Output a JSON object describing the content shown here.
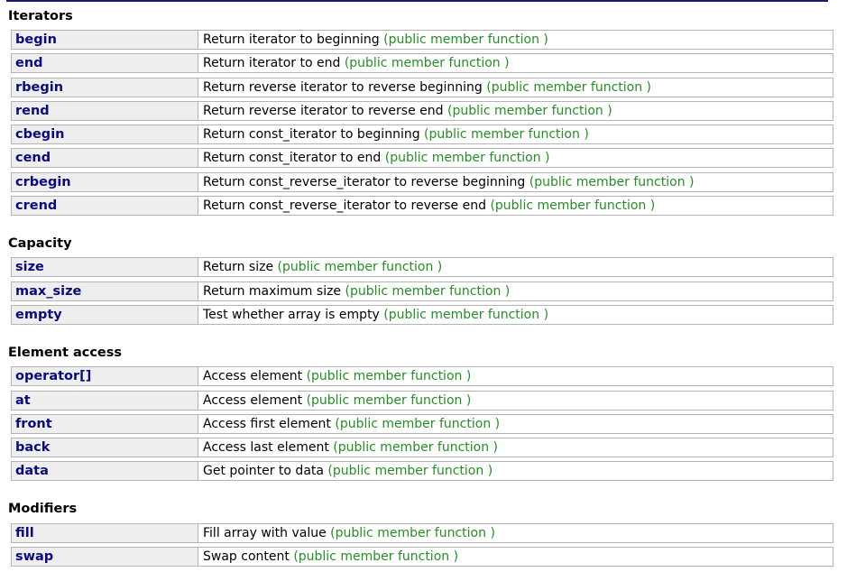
{
  "colors": {
    "name_text": "#0b0b7a",
    "kind_text": "#2a8a2a",
    "name_cell_bg": "#eeeeee",
    "border": "#b4b4b4",
    "top_rule": "#1a1a6e"
  },
  "sections": [
    {
      "title": "Iterators",
      "rows": [
        {
          "name": "begin",
          "desc": "Return iterator to beginning",
          "kind": "(public member function )"
        },
        {
          "name": "end",
          "desc": "Return iterator to end",
          "kind": "(public member function )"
        },
        {
          "name": "rbegin",
          "desc": "Return reverse iterator to reverse beginning",
          "kind": "(public member function )"
        },
        {
          "name": "rend",
          "desc": "Return reverse iterator to reverse end",
          "kind": "(public member function )"
        },
        {
          "name": "cbegin",
          "desc": "Return const_iterator to beginning",
          "kind": "(public member function )"
        },
        {
          "name": "cend",
          "desc": "Return const_iterator to end",
          "kind": "(public member function )"
        },
        {
          "name": "crbegin",
          "desc": "Return const_reverse_iterator to reverse beginning",
          "kind": "(public member function )"
        },
        {
          "name": "crend",
          "desc": "Return const_reverse_iterator to reverse end",
          "kind": "(public member function )"
        }
      ]
    },
    {
      "title": "Capacity",
      "rows": [
        {
          "name": "size",
          "desc": "Return size",
          "kind": "(public member function )"
        },
        {
          "name": "max_size",
          "desc": "Return maximum size",
          "kind": "(public member function )"
        },
        {
          "name": "empty",
          "desc": "Test whether array is empty",
          "kind": "(public member function )"
        }
      ]
    },
    {
      "title": "Element access",
      "rows": [
        {
          "name": "operator[]",
          "desc": "Access element",
          "kind": "(public member function )"
        },
        {
          "name": "at",
          "desc": "Access element",
          "kind": "(public member function )"
        },
        {
          "name": "front",
          "desc": "Access first element",
          "kind": "(public member function )"
        },
        {
          "name": "back",
          "desc": "Access last element",
          "kind": "(public member function )"
        },
        {
          "name": "data",
          "desc": "Get pointer to data",
          "kind": "(public member function )"
        }
      ]
    },
    {
      "title": "Modifiers",
      "rows": [
        {
          "name": "fill",
          "desc": "Fill array with value",
          "kind": "(public member function )"
        },
        {
          "name": "swap",
          "desc": "Swap content",
          "kind": "(public member function )"
        }
      ]
    }
  ]
}
